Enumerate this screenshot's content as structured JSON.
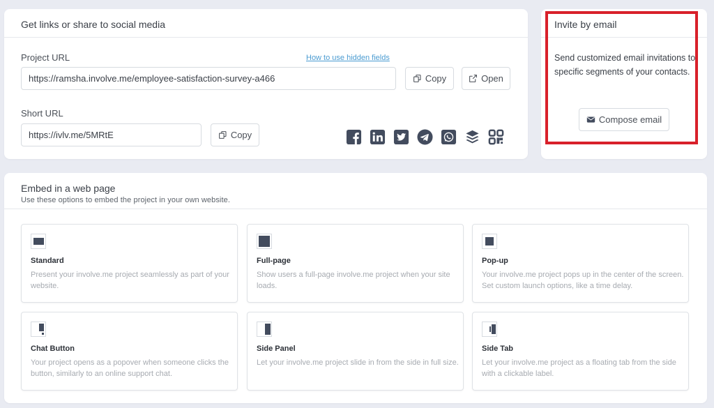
{
  "share": {
    "title": "Get links or share to social media",
    "project_url_label": "Project URL",
    "hidden_fields_link": "How to use hidden fields",
    "project_url_value": "https://ramsha.involve.me/employee-satisfaction-survey-a466",
    "copy_label": "Copy",
    "open_label": "Open",
    "short_url_label": "Short URL",
    "short_url_value": "https://ivlv.me/5MRtE",
    "short_copy_label": "Copy",
    "social_icons": [
      "facebook-icon",
      "linkedin-icon",
      "twitter-icon",
      "telegram-icon",
      "whatsapp-icon",
      "buffer-icon",
      "qr-code-icon"
    ]
  },
  "invite": {
    "title": "Invite by email",
    "description": "Send customized email invitations to specific segments of your contacts.",
    "compose_label": "Compose email",
    "highlight_color": "#d8202a"
  },
  "embed": {
    "title": "Embed in a web page",
    "subtitle": "Use these options to embed the project in your own website.",
    "options": [
      {
        "title": "Standard",
        "description": "Present your involve.me project seamlessly as part of your website."
      },
      {
        "title": "Full-page",
        "description": "Show users a full-page involve.me project when your site loads."
      },
      {
        "title": "Pop-up",
        "description": "Your involve.me project pops up in the center of the screen. Set custom launch options, like a time delay."
      },
      {
        "title": "Chat Button",
        "description": "Your project opens as a popover when someone clicks the button, similarly to an online support chat."
      },
      {
        "title": "Side Panel",
        "description": "Let your involve.me project slide in from the side in full size."
      },
      {
        "title": "Side Tab",
        "description": "Let your involve.me project as a floating tab from the side with a clickable label."
      }
    ]
  },
  "colors": {
    "background": "#e9ebf2",
    "icon_dark": "#434c5e",
    "link": "#4a9bd1"
  }
}
